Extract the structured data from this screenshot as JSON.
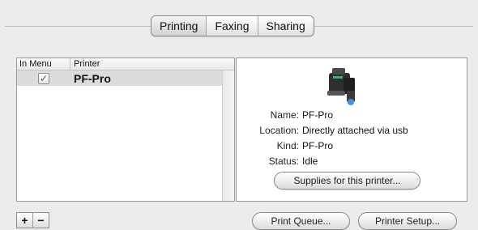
{
  "tabs": [
    {
      "label": "Printing",
      "selected": true
    },
    {
      "label": "Faxing",
      "selected": false
    },
    {
      "label": "Sharing",
      "selected": false
    }
  ],
  "printer_list": {
    "columns": [
      "In Menu",
      "Printer"
    ],
    "rows": [
      {
        "in_menu": true,
        "check_glyph": "✓",
        "name": "PF-Pro",
        "selected": true
      }
    ]
  },
  "details": {
    "icon": "printer-icon",
    "fields": [
      {
        "key": "Name:",
        "value": "PF-Pro"
      },
      {
        "key": "Location:",
        "value": "Directly attached via usb"
      },
      {
        "key": "Kind:",
        "value": "PF-Pro"
      },
      {
        "key": "Status:",
        "value": "Idle"
      }
    ],
    "supplies_label": "Supplies for this printer..."
  },
  "bottom": {
    "add_label": "+",
    "remove_label": "−",
    "print_queue_label": "Print Queue...",
    "printer_setup_label": "Printer Setup..."
  }
}
